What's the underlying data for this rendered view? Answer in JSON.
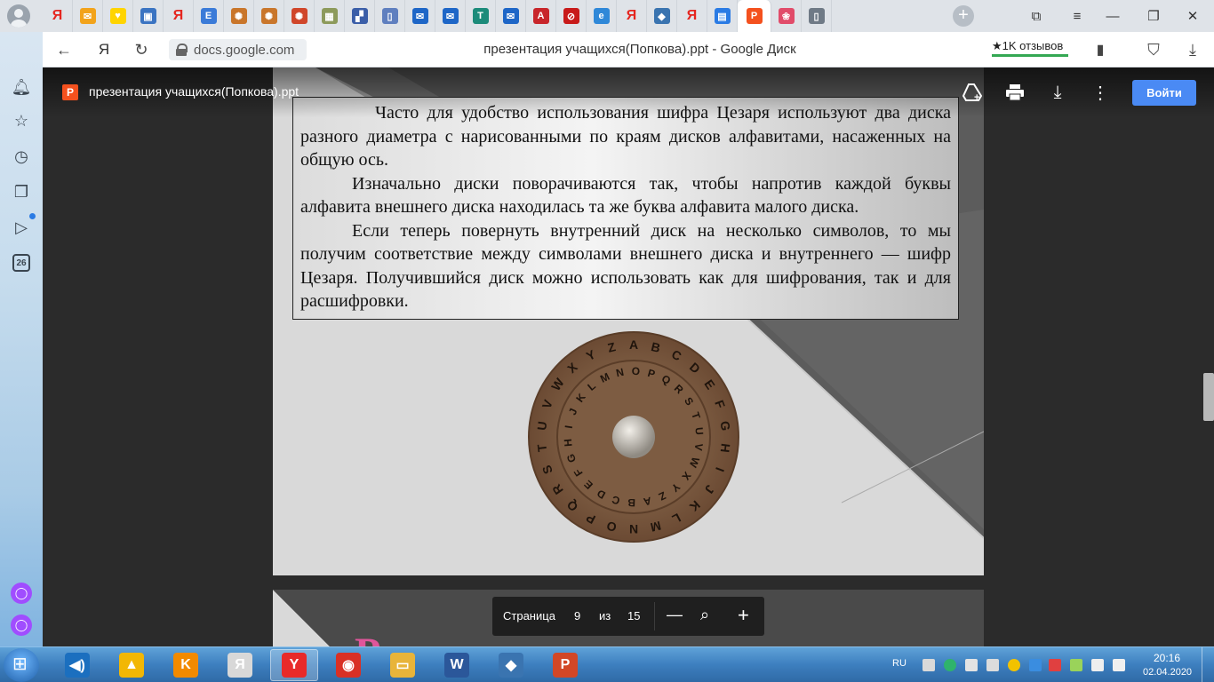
{
  "browser": {
    "tabs": [
      {
        "name": "yandex",
        "glyph": "Я",
        "color": "#e52620",
        "style": "ya"
      },
      {
        "name": "mail",
        "glyph": "✉",
        "color": "#f2a31b"
      },
      {
        "name": "shield",
        "glyph": "♥",
        "color": "#ffd400"
      },
      {
        "name": "chat",
        "glyph": "▣",
        "color": "#3b74c2"
      },
      {
        "name": "yandex",
        "glyph": "Я",
        "color": "#e52620",
        "style": "ya"
      },
      {
        "name": "wiki",
        "glyph": "E",
        "color": "#3b7bd8"
      },
      {
        "name": "compass",
        "glyph": "✺",
        "color": "#c9762b"
      },
      {
        "name": "compass",
        "glyph": "✺",
        "color": "#c9762b"
      },
      {
        "name": "compass",
        "glyph": "✺",
        "color": "#d0462a"
      },
      {
        "name": "game",
        "glyph": "▦",
        "color": "#8d9a5b"
      },
      {
        "name": "grid",
        "glyph": "▞",
        "color": "#3b5ea8"
      },
      {
        "name": "doc",
        "glyph": "▯",
        "color": "#5f7fbf"
      },
      {
        "name": "mail",
        "glyph": "✉",
        "color": "#1e66c7"
      },
      {
        "name": "mail",
        "glyph": "✉",
        "color": "#1e66c7"
      },
      {
        "name": "translate",
        "glyph": "T",
        "color": "#1c8b7a"
      },
      {
        "name": "mail",
        "glyph": "✉",
        "color": "#1e66c7"
      },
      {
        "name": "pdf",
        "glyph": "A",
        "color": "#c8262b"
      },
      {
        "name": "no",
        "glyph": "⊘",
        "color": "#c81a1a"
      },
      {
        "name": "edge",
        "glyph": "e",
        "color": "#2f88d8"
      },
      {
        "name": "yandex",
        "glyph": "Я",
        "color": "#e52620",
        "style": "ya"
      },
      {
        "name": "python",
        "glyph": "◆",
        "color": "#3a74b0"
      },
      {
        "name": "yandex",
        "glyph": "Я",
        "color": "#e52620",
        "style": "ya"
      },
      {
        "name": "slides",
        "glyph": "▤",
        "color": "#2a7be4"
      },
      {
        "name": "powerpoint",
        "glyph": "P",
        "color": "#f4511e",
        "active": true
      },
      {
        "name": "image",
        "glyph": "❀",
        "color": "#e14c6a"
      },
      {
        "name": "page",
        "glyph": "▯",
        "color": "#6f7a86"
      }
    ],
    "new_tab": "+",
    "url": "docs.google.com",
    "page_title": "презентация учащихся(Попкова).ppt - Google Диск",
    "reviews": "★1K отзывов"
  },
  "viewer": {
    "file_name": "презентация учащихся(Попкова).ppt",
    "file_glyph": "P",
    "open_button": "Войти",
    "pager": {
      "label": "Страница",
      "current": "9",
      "of": "из",
      "total": "15",
      "minus": "—",
      "plus": "+"
    }
  },
  "slide": {
    "paragraphs": [
      "Часто для удобство использования шифра Цезаря используют два диска разного диаметра с нарисованными по краям дисков алфавитами, насаженных на общую ось.",
      "Изначально диски поворачиваются так, чтобы напротив каждой буквы алфавита внешнего диска находилась та же буква алфавита малого диска.",
      "Если теперь повернуть внутренний диск на несколько символов, то мы получим соответствие между символами внешнего диска и внутреннего — шифр Цезаря. Получившийся диск можно использовать как для шифрования, так и для расшифровки."
    ],
    "outer_ring": "ABCDEFGHIJKLMNOPQRSTUVWXYZ",
    "inner_ring": "NOPQRSTUVWXYZABCDEFGHIJKLM",
    "next_slide_fragment": "Р"
  },
  "sidebar": {
    "calendar_day": "26"
  },
  "taskbar": {
    "apps": [
      {
        "name": "audio",
        "glyph": "◀)",
        "color": "#1b6fbf"
      },
      {
        "name": "aimp",
        "glyph": "▲",
        "color": "#f2b705"
      },
      {
        "name": "kinopoisk",
        "glyph": "K",
        "color": "#f28a00"
      },
      {
        "name": "yandex-browser-alt",
        "glyph": "Я",
        "color": "#d8d8d8"
      },
      {
        "name": "yandex-browser",
        "glyph": "Y",
        "color": "#e82a2a",
        "open": true
      },
      {
        "name": "chrome",
        "glyph": "◉",
        "color": "#d93025"
      },
      {
        "name": "explorer",
        "glyph": "▭",
        "color": "#e8b43a"
      },
      {
        "name": "word",
        "glyph": "W",
        "color": "#2b579a"
      },
      {
        "name": "python-idle",
        "glyph": "◆",
        "color": "#3a74b0"
      },
      {
        "name": "powerpoint",
        "glyph": "P",
        "color": "#d24726"
      }
    ],
    "lang": "RU",
    "time": "20:16",
    "date": "02.04.2020"
  }
}
